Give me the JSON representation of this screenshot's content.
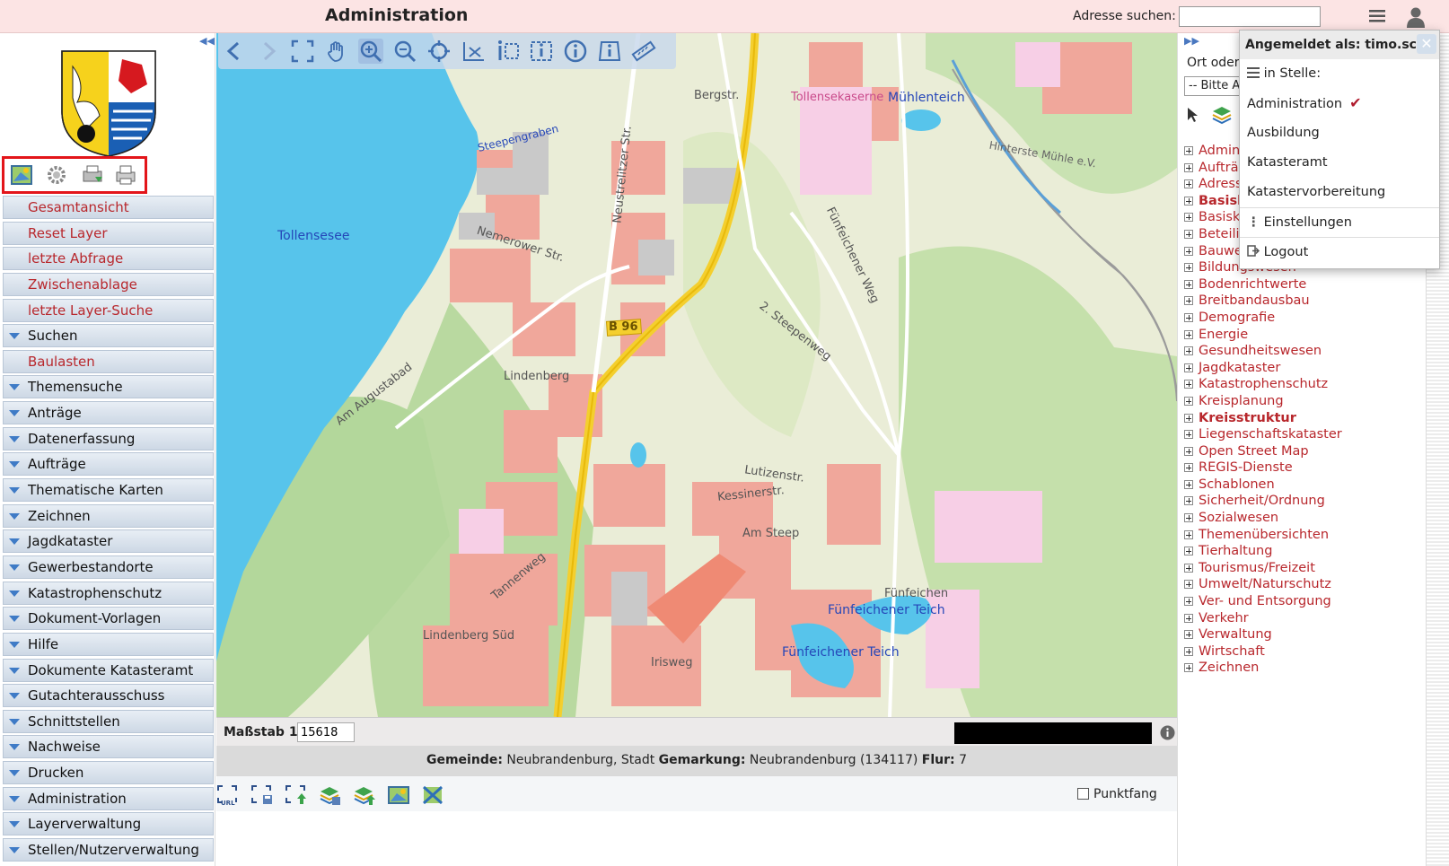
{
  "header": {
    "title": "Administration",
    "address_label": "Adresse suchen:",
    "address_value": ""
  },
  "sidebar": {
    "items": [
      {
        "label": "Gesamtansicht",
        "type": "link"
      },
      {
        "label": "Reset Layer",
        "type": "link"
      },
      {
        "label": "letzte Abfrage",
        "type": "link"
      },
      {
        "label": "Zwischenablage",
        "type": "link"
      },
      {
        "label": "letzte Layer-Suche",
        "type": "link"
      },
      {
        "label": "Suchen",
        "type": "group"
      },
      {
        "label": "Baulasten",
        "type": "link"
      },
      {
        "label": "Themensuche",
        "type": "group"
      },
      {
        "label": "Anträge",
        "type": "group"
      },
      {
        "label": "Datenerfassung",
        "type": "group"
      },
      {
        "label": "Aufträge",
        "type": "group"
      },
      {
        "label": "Thematische Karten",
        "type": "group"
      },
      {
        "label": "Zeichnen",
        "type": "group"
      },
      {
        "label": "Jagdkataster",
        "type": "group"
      },
      {
        "label": "Gewerbestandorte",
        "type": "group"
      },
      {
        "label": "Katastrophenschutz",
        "type": "group"
      },
      {
        "label": "Dokument-Vorlagen",
        "type": "group"
      },
      {
        "label": "Hilfe",
        "type": "group"
      },
      {
        "label": "Dokumente Katasteramt",
        "type": "group"
      },
      {
        "label": "Gutachterausschuss",
        "type": "group"
      },
      {
        "label": "Schnittstellen",
        "type": "group"
      },
      {
        "label": "Nachweise",
        "type": "group"
      },
      {
        "label": "Drucken",
        "type": "group"
      },
      {
        "label": "Administration",
        "type": "group"
      },
      {
        "label": "Layerverwaltung",
        "type": "group"
      },
      {
        "label": "Stellen/Nutzerverwaltung",
        "type": "group"
      }
    ]
  },
  "map": {
    "labels": {
      "lake": "Tollensesee",
      "muehlenteich": "Mühlenteich",
      "teich1": "Fünfeichener Teich",
      "teich2": "Fünfeichener Teich",
      "b96": "B 96",
      "steepengraben": "Steepengraben",
      "nemerower": "Nemerower Str.",
      "lindenberg": "Lindenberg",
      "lindenberg_sued": "Lindenberg Süd",
      "augustabad": "Am Augustabad",
      "tollensekaserne": "Tollensekaserne",
      "bergstr": "Bergstr.",
      "neustrelitzer": "Neustrelitzer Str.",
      "fuenfeichener_weg": "Fünfeichener Weg",
      "steepenweg": "2. Steepenweg",
      "am_steep": "Am Steep",
      "lutizenstr": "Lutizenstr.",
      "kessinerstr": "Kessinerstr.",
      "fuenfeichen": "Fünfeichen",
      "hinterste_muehle": "Hinterste Mühle e.V.",
      "tannenweg": "Tannenweg",
      "irisweg": "Irisweg"
    }
  },
  "status": {
    "scale_label": "Maßstab 1:",
    "scale_value": "15618",
    "gemeinde_label": "Gemeinde:",
    "gemeinde_value": "Neubrandenburg, Stadt",
    "gemarkung_label": "Gemarkung:",
    "gemarkung_value": "Neubrandenburg (134117)",
    "flur_label": "Flur:",
    "flur_value": "7",
    "punktfang_label": "Punktfang"
  },
  "rightpanel": {
    "ort_label": "Ort oder",
    "select_value": "-- Bitte Au",
    "layers": [
      {
        "label": "Admini",
        "bold": false
      },
      {
        "label": "Aufträg",
        "bold": false
      },
      {
        "label": "Adress",
        "bold": false
      },
      {
        "label": "Basisk",
        "bold": true
      },
      {
        "label": "Basisk",
        "bold": false
      },
      {
        "label": "Beteilig",
        "bold": false
      },
      {
        "label": "Bauwe",
        "bold": false
      },
      {
        "label": "Bildungswesen",
        "bold": false
      },
      {
        "label": "Bodenrichtwerte",
        "bold": false
      },
      {
        "label": "Breitbandausbau",
        "bold": false
      },
      {
        "label": "Demografie",
        "bold": false
      },
      {
        "label": "Energie",
        "bold": false
      },
      {
        "label": "Gesundheitswesen",
        "bold": false
      },
      {
        "label": "Jagdkataster",
        "bold": false
      },
      {
        "label": "Katastrophenschutz",
        "bold": false
      },
      {
        "label": "Kreisplanung",
        "bold": false
      },
      {
        "label": "Kreisstruktur",
        "bold": true
      },
      {
        "label": "Liegenschaftskataster",
        "bold": false
      },
      {
        "label": "Open Street Map",
        "bold": false
      },
      {
        "label": "REGIS-Dienste",
        "bold": false
      },
      {
        "label": "Schablonen",
        "bold": false
      },
      {
        "label": "Sicherheit/Ordnung",
        "bold": false
      },
      {
        "label": "Sozialwesen",
        "bold": false
      },
      {
        "label": "Themenübersichten",
        "bold": false
      },
      {
        "label": "Tierhaltung",
        "bold": false
      },
      {
        "label": "Tourismus/Freizeit",
        "bold": false
      },
      {
        "label": "Umwelt/Naturschutz",
        "bold": false
      },
      {
        "label": "Ver- und Entsorgung",
        "bold": false
      },
      {
        "label": "Verkehr",
        "bold": false
      },
      {
        "label": "Verwaltung",
        "bold": false
      },
      {
        "label": "Wirtschaft",
        "bold": false
      },
      {
        "label": "Zeichnen",
        "bold": false
      }
    ]
  },
  "userpopup": {
    "header": "Angemeldet als: timo.sche",
    "close": "✕",
    "in_stelle": "in Stelle:",
    "stellen": [
      "Administration",
      "Ausbildung",
      "Katasteramt",
      "Katastervorbereitung"
    ],
    "selected_check": "✔",
    "einstellungen": "Einstellungen",
    "logout": "Logout"
  },
  "colors": {
    "header_bg": "#fce4e4",
    "link_red": "#b8272c",
    "accent_blue": "#3f7bc6",
    "highlight_red": "#e3151a"
  }
}
